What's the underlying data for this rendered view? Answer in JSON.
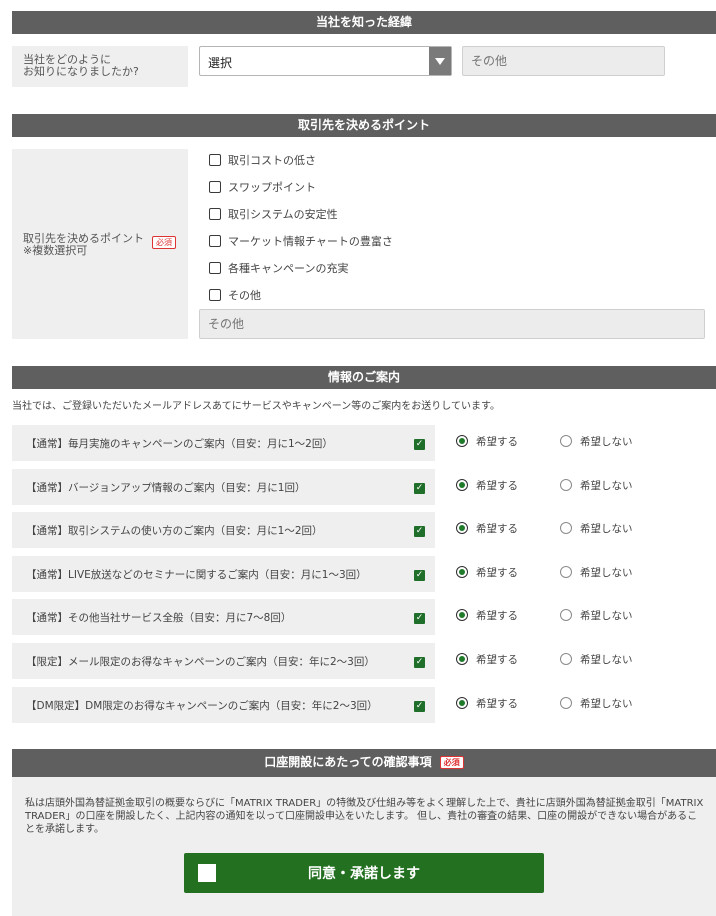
{
  "section_discovery": {
    "header": "当社を知った経緯",
    "question": "当社をどのように\nお知りになりましたか?",
    "select_value": "選択",
    "other_placeholder": "その他"
  },
  "section_points": {
    "header": "取引先を決めるポイント",
    "label_line1": "取引先を決めるポイント",
    "label_line2": "※複数選択可",
    "required": "必須",
    "options": [
      "取引コストの低さ",
      "スワップポイント",
      "取引システムの安定性",
      "マーケット情報チャートの豊富さ",
      "各種キャンペーンの充実",
      "その他"
    ],
    "other_placeholder": "その他"
  },
  "section_info": {
    "header": "情報のご案内",
    "intro": "当社では、ご登録いただいたメールアドレスあてにサービスやキャンペーン等のご案内をお送りしています。",
    "yes_label": "希望する",
    "no_label": "希望しない",
    "rows": [
      "【通常】毎月実施のキャンペーンのご案内（目安：月に1〜2回）",
      "【通常】バージョンアップ情報のご案内（目安：月に1回）",
      "【通常】取引システムの使い方のご案内（目安：月に1〜2回）",
      "【通常】LIVE放送などのセミナーに関するご案内（目安：月に1〜3回）",
      "【通常】その他当社サービス全般（目安：月に7〜8回）",
      "【限定】メール限定のお得なキャンペーンのご案内（目安：年に2〜3回）",
      "【DM限定】DM限定のお得なキャンペーンのご案内（目安：年に2〜3回）"
    ]
  },
  "section_confirm": {
    "header": "口座開設にあたっての確認事項",
    "required": "必須",
    "body": "私は店頭外国為替証拠金取引の概要ならびに「MATRIX TRADER」の特徴及び仕組み等をよく理解した上で、貴社に店頭外国為替証拠金取引「MATRIX TRADER」の口座を開設したく、上記内容の通知を以って口座開設申込をいたします。 但し、貴社の審査の結果、口座の開設ができない場合があることを承諾します。",
    "agree_label": "同意・承諾します"
  },
  "colors": {
    "header_bg": "#5f5f5f",
    "accent_green": "#227020",
    "required_red": "#dd3333"
  }
}
